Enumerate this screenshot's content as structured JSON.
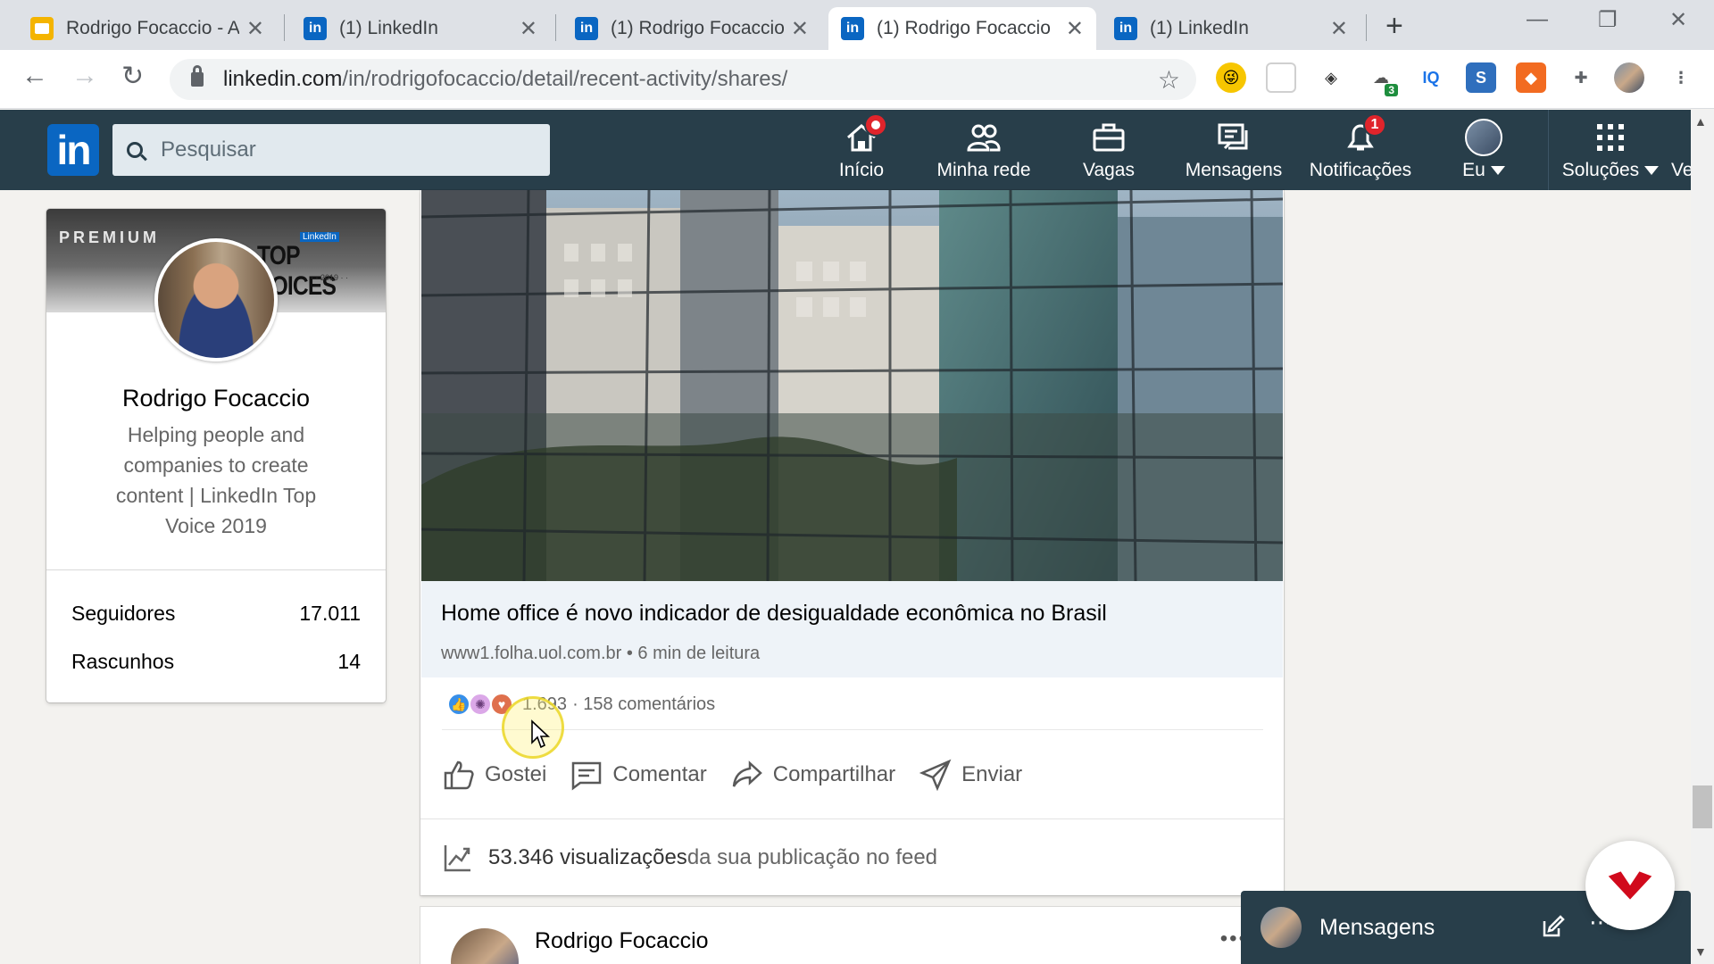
{
  "browser": {
    "tabs": [
      {
        "title": "Rodrigo Focaccio - A",
        "favicon": "slides-icon"
      },
      {
        "title": "(1) LinkedIn",
        "favicon": "linkedin-icon"
      },
      {
        "title": "(1) Rodrigo Focaccio",
        "favicon": "linkedin-icon"
      },
      {
        "title": "(1) Rodrigo Focaccio",
        "favicon": "linkedin-icon"
      },
      {
        "title": "(1) LinkedIn",
        "favicon": "linkedin-icon"
      }
    ],
    "active_tab": 3,
    "url_host": "linkedin.com",
    "url_path": "/in/rodrigofocaccio/detail/recent-activity/shares/",
    "extension_badge": "3",
    "extension_iq": "IQ"
  },
  "linkedin": {
    "logo": "in",
    "search_placeholder": "Pesquisar",
    "nav": {
      "home": "Início",
      "network": "Minha rede",
      "jobs": "Vagas",
      "messages": "Mensagens",
      "notifications": "Notificações",
      "notifications_badge": "1",
      "me": "Eu",
      "solutions": "Soluções",
      "more_cut": "Ve"
    }
  },
  "profile": {
    "premium": "PREMIUM",
    "top_voices_small": "LinkedIn",
    "top_voices": "TOP VOICES",
    "top_voices_year": "· · 2019 · ·",
    "name": "Rodrigo Focaccio",
    "headline": "Helping people and companies to create content | LinkedIn Top Voice 2019",
    "stats": [
      {
        "label": "Seguidores",
        "value": "17.011"
      },
      {
        "label": "Rascunhos",
        "value": "14"
      }
    ]
  },
  "post": {
    "title": "Home office é novo indicador de desigualdade econômica no Brasil",
    "source": "www1.folha.uol.com.br • 6 min de leitura",
    "reactions_count": "1.693",
    "comments": "· 158 comentários",
    "actions": {
      "like": "Gostei",
      "comment": "Comentar",
      "share": "Compartilhar",
      "send": "Enviar"
    },
    "views_count": "53.346 visualizações",
    "views_suffix": " da sua publicação no feed"
  },
  "next_post": {
    "author": "Rodrigo Focaccio"
  },
  "messaging": {
    "label": "Mensagens"
  },
  "colors": {
    "linkedin_blue": "#0a66c2",
    "header_bg": "#283e4a",
    "badge_red": "#e0242b"
  }
}
